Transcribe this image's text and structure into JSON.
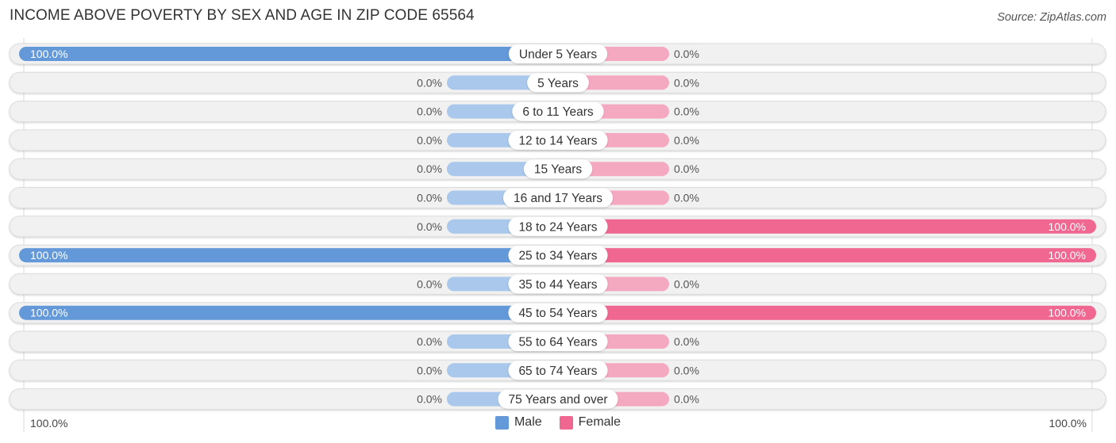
{
  "title": "INCOME ABOVE POVERTY BY SEX AND AGE IN ZIP CODE 65564",
  "source": "Source: ZipAtlas.com",
  "colors": {
    "male": "#6399d8",
    "male_light": "#a9c8eb",
    "female": "#f06791",
    "female_light": "#f5a9c1",
    "track": "#f1f1f1",
    "track_border": "#dcdcdc"
  },
  "legend": [
    {
      "label": "Male",
      "color": "#6399d8"
    },
    {
      "label": "Female",
      "color": "#f06791"
    }
  ],
  "axis": {
    "left_label": "100.0%",
    "right_label": "100.0%"
  },
  "chart_data": {
    "type": "bar",
    "orientation": "horizontal-diverging",
    "title": "INCOME ABOVE POVERTY BY SEX AND AGE IN ZIP CODE 65564",
    "xlabel": "",
    "ylabel": "",
    "xlim": [
      -100,
      100
    ],
    "legend_position": "bottom-center",
    "categories": [
      "Under 5 Years",
      "5 Years",
      "6 to 11 Years",
      "12 to 14 Years",
      "15 Years",
      "16 and 17 Years",
      "18 to 24 Years",
      "25 to 34 Years",
      "35 to 44 Years",
      "45 to 54 Years",
      "55 to 64 Years",
      "65 to 74 Years",
      "75 Years and over"
    ],
    "series": [
      {
        "name": "Male",
        "values": [
          100,
          0,
          0,
          0,
          0,
          0,
          0,
          100,
          0,
          100,
          0,
          0,
          0
        ],
        "labels": [
          "100.0%",
          "0.0%",
          "0.0%",
          "0.0%",
          "0.0%",
          "0.0%",
          "0.0%",
          "100.0%",
          "0.0%",
          "100.0%",
          "0.0%",
          "0.0%",
          "0.0%"
        ]
      },
      {
        "name": "Female",
        "values": [
          0,
          0,
          0,
          0,
          0,
          0,
          100,
          100,
          0,
          100,
          0,
          0,
          0
        ],
        "labels": [
          "0.0%",
          "0.0%",
          "0.0%",
          "0.0%",
          "0.0%",
          "0.0%",
          "100.0%",
          "100.0%",
          "0.0%",
          "100.0%",
          "0.0%",
          "0.0%",
          "0.0%"
        ]
      }
    ]
  }
}
